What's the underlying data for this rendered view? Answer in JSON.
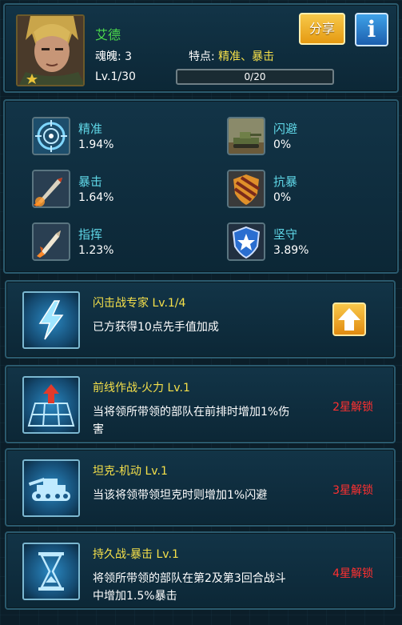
{
  "header": {
    "name": "艾德",
    "soul": "魂魄: 3",
    "traits_label": "特点:",
    "traits_value": "精准、暴击",
    "level": "Lv.1/30",
    "progress_text": "0/20",
    "progress_fraction": 0,
    "share_label": "分享",
    "info_label": "i"
  },
  "stats": [
    {
      "label": "精准",
      "value": "1.94%",
      "icon": "crosshair-icon"
    },
    {
      "label": "闪避",
      "value": "0%",
      "icon": "tank-icon"
    },
    {
      "label": "暴击",
      "value": "1.64%",
      "icon": "missile-icon"
    },
    {
      "label": "抗暴",
      "value": "0%",
      "icon": "striped-shield-icon"
    },
    {
      "label": "指挥",
      "value": "1.23%",
      "icon": "rocket-icon"
    },
    {
      "label": "坚守",
      "value": "3.89%",
      "icon": "star-shield-icon"
    }
  ],
  "skills": [
    {
      "name": "闪击战专家 Lv.1/4",
      "desc": "已方获得10点先手值加成",
      "lock": "",
      "icon": "lightning-icon"
    },
    {
      "name": "前线作战-火力 Lv.1",
      "desc": "当将领所带领的部队在前排时增加1%伤害",
      "lock": "2星解锁",
      "icon": "front-line-icon"
    },
    {
      "name": "坦克-机动 Lv.1",
      "desc": "当该将领带领坦克时则增加1%闪避",
      "lock": "3星解锁",
      "icon": "tank-icon"
    },
    {
      "name": "持久战-暴击 Lv.1",
      "desc": "将领所带领的部队在第2及第3回合战斗中增加1.5%暴击",
      "lock": "4星解锁",
      "icon": "hourglass-icon"
    }
  ],
  "colors": {
    "name_green": "#4cd94c",
    "stat_cyan": "#5fd6e6",
    "skill_yellow": "#f5e04a",
    "lock_red": "#ff3030",
    "share_orange": "#e59a12",
    "info_blue": "#1c5fae"
  }
}
